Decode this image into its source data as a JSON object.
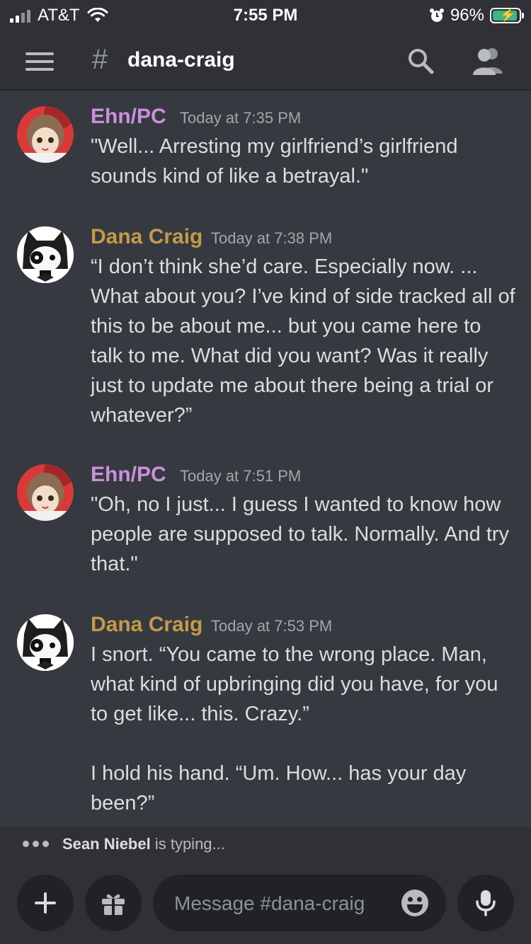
{
  "status": {
    "carrier": "AT&T",
    "time": "7:55 PM",
    "battery": "96%",
    "battery_level": 0.96
  },
  "header": {
    "channel": "dana-craig"
  },
  "messages": [
    {
      "author": "Ehn/PC",
      "color": "#c990dc",
      "time": "Today at 7:35 PM",
      "text": "\"Well... Arresting my girlfriend’s girlfriend sounds kind of like a betrayal.\""
    },
    {
      "author": "Dana Craig",
      "color": "#c49a4a",
      "time": "Today at 7:38 PM",
      "text": "“I don’t think she’d care. Especially now. ... What about you? I’ve kind of side tracked all of this to be about me... but you came here to talk to me. What did you want? Was it really just to update me about there being a trial or whatever?”"
    },
    {
      "author": "Ehn/PC",
      "color": "#c990dc",
      "time": "Today at 7:51 PM",
      "text": "\"Oh, no I just... I guess I wanted to know how people are supposed to talk. Normally. And try that.\""
    },
    {
      "author": "Dana Craig",
      "color": "#c49a4a",
      "time": "Today at 7:53 PM",
      "text": "I snort. “You came to the wrong place. Man, what kind of upbringing did you have, for you to get like... this. Crazy.”\n\nI hold his hand. “Um. How... has your day been?”"
    }
  ],
  "typing": {
    "user": "Sean Niebel",
    "suffix": " is typing..."
  },
  "composer": {
    "placeholder": "Message #dana-craig"
  }
}
